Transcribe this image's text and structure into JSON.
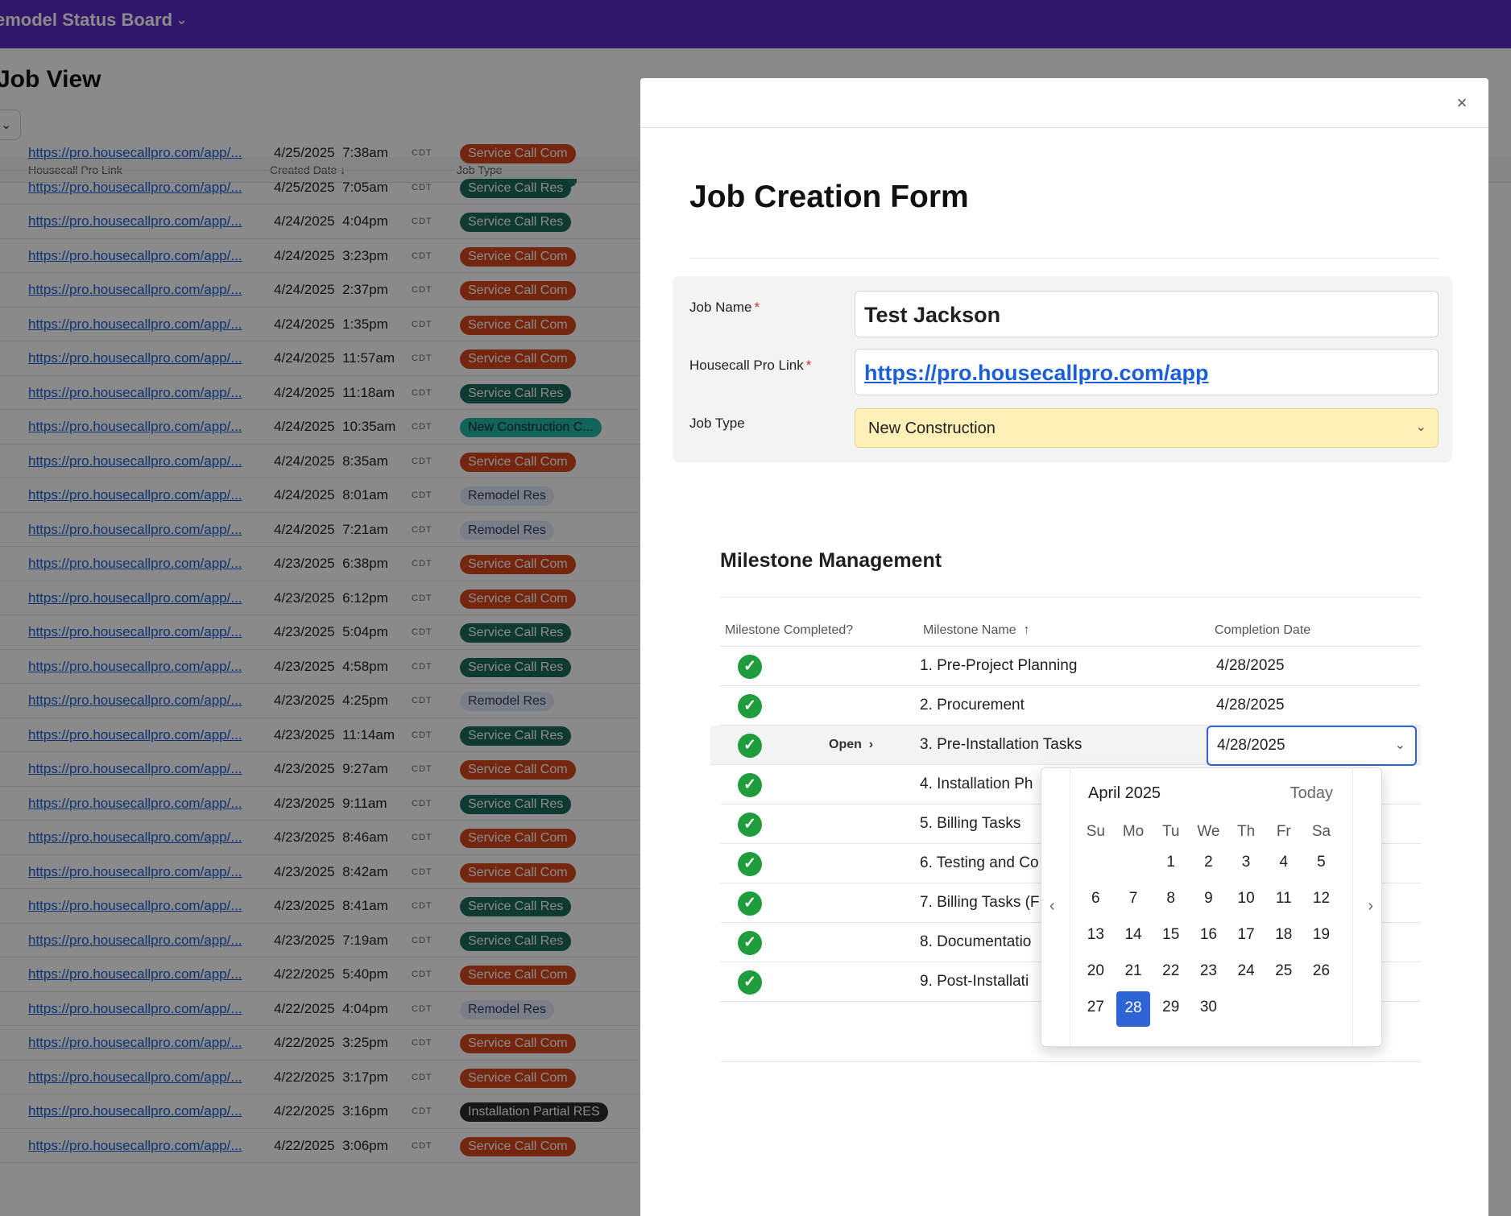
{
  "app": {
    "board_title": "emodel Status Board",
    "page_title": "Job View"
  },
  "grid": {
    "headers": {
      "link": "Housecall Pro Link",
      "created": "Created Date",
      "type": "Job Type"
    },
    "sort_icon": "arrow-down-icon",
    "rows": [
      {
        "link": "https://pro.housecallpro.com/app/...",
        "date": "4/25/2025",
        "time": "7:38am",
        "tz": "CDT",
        "type": "Service Call Com",
        "kind": "com"
      },
      {
        "link": "https://pro.housecallpro.com/app/...",
        "date": "4/25/2025",
        "time": "7:05am",
        "tz": "CDT",
        "type": "Service Call Res",
        "kind": "res"
      },
      {
        "link": "https://pro.housecallpro.com/app/...",
        "date": "4/24/2025",
        "time": "4:04pm",
        "tz": "CDT",
        "type": "Service Call Res",
        "kind": "res"
      },
      {
        "link": "https://pro.housecallpro.com/app/...",
        "date": "4/24/2025",
        "time": "3:23pm",
        "tz": "CDT",
        "type": "Service Call Com",
        "kind": "com"
      },
      {
        "link": "https://pro.housecallpro.com/app/...",
        "date": "4/24/2025",
        "time": "2:37pm",
        "tz": "CDT",
        "type": "Service Call Com",
        "kind": "com"
      },
      {
        "link": "https://pro.housecallpro.com/app/...",
        "date": "4/24/2025",
        "time": "1:35pm",
        "tz": "CDT",
        "type": "Service Call Com",
        "kind": "com"
      },
      {
        "link": "https://pro.housecallpro.com/app/...",
        "date": "4/24/2025",
        "time": "11:57am",
        "tz": "CDT",
        "type": "Service Call Com",
        "kind": "com"
      },
      {
        "link": "https://pro.housecallpro.com/app/...",
        "date": "4/24/2025",
        "time": "11:18am",
        "tz": "CDT",
        "type": "Service Call Res",
        "kind": "res"
      },
      {
        "link": "https://pro.housecallpro.com/app/...",
        "date": "4/24/2025",
        "time": "10:35am",
        "tz": "CDT",
        "type": "New Construction C...",
        "kind": "new"
      },
      {
        "link": "https://pro.housecallpro.com/app/...",
        "date": "4/24/2025",
        "time": "8:35am",
        "tz": "CDT",
        "type": "Service Call Com",
        "kind": "com"
      },
      {
        "link": "https://pro.housecallpro.com/app/...",
        "date": "4/24/2025",
        "time": "8:01am",
        "tz": "CDT",
        "type": "Remodel Res",
        "kind": "remodel"
      },
      {
        "link": "https://pro.housecallpro.com/app/...",
        "date": "4/24/2025",
        "time": "7:21am",
        "tz": "CDT",
        "type": "Remodel Res",
        "kind": "remodel"
      },
      {
        "link": "https://pro.housecallpro.com/app/...",
        "date": "4/23/2025",
        "time": "6:38pm",
        "tz": "CDT",
        "type": "Service Call Com",
        "kind": "com"
      },
      {
        "link": "https://pro.housecallpro.com/app/...",
        "date": "4/23/2025",
        "time": "6:12pm",
        "tz": "CDT",
        "type": "Service Call Com",
        "kind": "com"
      },
      {
        "link": "https://pro.housecallpro.com/app/...",
        "date": "4/23/2025",
        "time": "5:04pm",
        "tz": "CDT",
        "type": "Service Call Res",
        "kind": "res"
      },
      {
        "link": "https://pro.housecallpro.com/app/...",
        "date": "4/23/2025",
        "time": "4:58pm",
        "tz": "CDT",
        "type": "Service Call Res",
        "kind": "res"
      },
      {
        "link": "https://pro.housecallpro.com/app/...",
        "date": "4/23/2025",
        "time": "4:25pm",
        "tz": "CDT",
        "type": "Remodel Res",
        "kind": "remodel"
      },
      {
        "link": "https://pro.housecallpro.com/app/...",
        "date": "4/23/2025",
        "time": "11:14am",
        "tz": "CDT",
        "type": "Service Call Res",
        "kind": "res"
      },
      {
        "link": "https://pro.housecallpro.com/app/...",
        "date": "4/23/2025",
        "time": "9:27am",
        "tz": "CDT",
        "type": "Service Call Com",
        "kind": "com"
      },
      {
        "link": "https://pro.housecallpro.com/app/...",
        "date": "4/23/2025",
        "time": "9:11am",
        "tz": "CDT",
        "type": "Service Call Res",
        "kind": "res"
      },
      {
        "link": "https://pro.housecallpro.com/app/...",
        "date": "4/23/2025",
        "time": "8:46am",
        "tz": "CDT",
        "type": "Service Call Com",
        "kind": "com"
      },
      {
        "link": "https://pro.housecallpro.com/app/...",
        "date": "4/23/2025",
        "time": "8:42am",
        "tz": "CDT",
        "type": "Service Call Com",
        "kind": "com"
      },
      {
        "link": "https://pro.housecallpro.com/app/...",
        "date": "4/23/2025",
        "time": "8:41am",
        "tz": "CDT",
        "type": "Service Call Res",
        "kind": "res"
      },
      {
        "link": "https://pro.housecallpro.com/app/...",
        "date": "4/23/2025",
        "time": "7:19am",
        "tz": "CDT",
        "type": "Service Call Res",
        "kind": "res"
      },
      {
        "link": "https://pro.housecallpro.com/app/...",
        "date": "4/22/2025",
        "time": "5:40pm",
        "tz": "CDT",
        "type": "Service Call Com",
        "kind": "com"
      },
      {
        "link": "https://pro.housecallpro.com/app/...",
        "date": "4/22/2025",
        "time": "4:04pm",
        "tz": "CDT",
        "type": "Remodel Res",
        "kind": "remodel"
      },
      {
        "link": "https://pro.housecallpro.com/app/...",
        "date": "4/22/2025",
        "time": "3:25pm",
        "tz": "CDT",
        "type": "Service Call Com",
        "kind": "com"
      },
      {
        "link": "https://pro.housecallpro.com/app/...",
        "date": "4/22/2025",
        "time": "3:17pm",
        "tz": "CDT",
        "type": "Service Call Com",
        "kind": "com"
      },
      {
        "link": "https://pro.housecallpro.com/app/...",
        "date": "4/22/2025",
        "time": "3:16pm",
        "tz": "CDT",
        "type": "Installation Partial RES",
        "kind": "install"
      },
      {
        "link": "https://pro.housecallpro.com/app/...",
        "date": "4/22/2025",
        "time": "3:06pm",
        "tz": "CDT",
        "type": "Service Call Com",
        "kind": "com"
      }
    ]
  },
  "modal": {
    "close_label": "×",
    "form_title": "Job Creation Form",
    "fields": {
      "job_name_label": "Job Name",
      "job_name_value": "Test Jackson",
      "link_label": "Housecall Pro Link",
      "link_value": "https://pro.housecallpro.com/app",
      "job_type_label": "Job Type",
      "job_type_value": "New Construction",
      "required_mark": "*"
    },
    "milestones": {
      "title": "Milestone Management",
      "headers": {
        "completed": "Milestone Completed?",
        "name": "Milestone Name",
        "date": "Completion Date"
      },
      "sort_icon": "arrow-up-icon",
      "open_label": "Open",
      "rows": [
        {
          "name": "1. Pre-Project Planning",
          "date": "4/28/2025"
        },
        {
          "name": "2. Procurement",
          "date": "4/28/2025"
        },
        {
          "name": "3. Pre-Installation Tasks",
          "date": "4/28/2025"
        },
        {
          "name": "4. Installation Ph",
          "date": ""
        },
        {
          "name": "5. Billing Tasks",
          "date": ""
        },
        {
          "name": "6. Testing and Co",
          "date": ""
        },
        {
          "name": "7. Billing Tasks (F",
          "date": ""
        },
        {
          "name": "8. Documentatio",
          "date": ""
        },
        {
          "name": "9. Post-Installati",
          "date": ""
        }
      ]
    },
    "calendar": {
      "month": "April 2025",
      "today_label": "Today",
      "weekdays": [
        "Su",
        "Mo",
        "Tu",
        "We",
        "Th",
        "Fr",
        "Sa"
      ],
      "weeks": [
        [
          "",
          "",
          "1",
          "2",
          "3",
          "4",
          "5"
        ],
        [
          "6",
          "7",
          "8",
          "9",
          "10",
          "11",
          "12"
        ],
        [
          "13",
          "14",
          "15",
          "16",
          "17",
          "18",
          "19"
        ],
        [
          "20",
          "21",
          "22",
          "23",
          "24",
          "25",
          "26"
        ],
        [
          "27",
          "28",
          "29",
          "30",
          "",
          "",
          ""
        ]
      ],
      "selected": "28"
    }
  },
  "colors": {
    "topbar": "#5a2bc4",
    "accent_blue": "#2d63d4",
    "check_green": "#1f9d3c",
    "job_type_bg": "#fff0b8"
  }
}
